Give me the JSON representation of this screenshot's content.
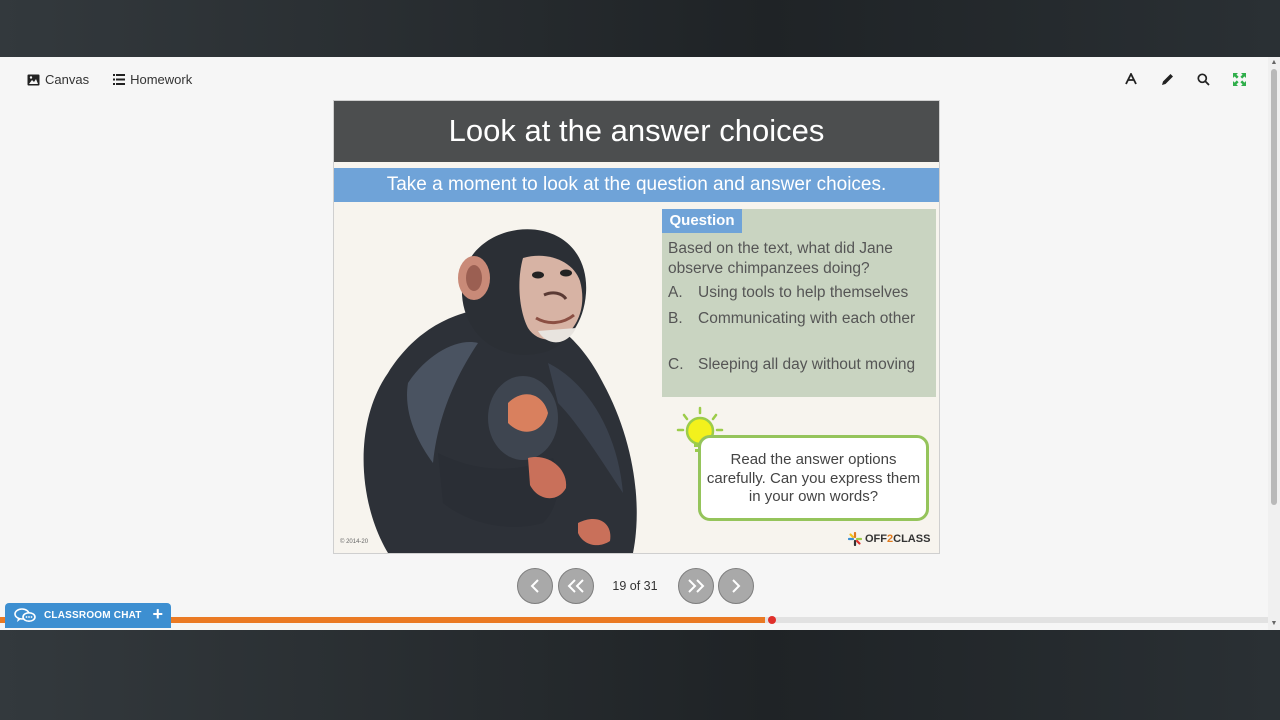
{
  "toolbar": {
    "canvas_label": "Canvas",
    "homework_label": "Homework",
    "icons": [
      "font-icon",
      "pencil-icon",
      "search-icon",
      "fullscreen-icon"
    ]
  },
  "slide": {
    "title": "Look at the answer choices",
    "subtitle": "Take a moment to look at the question and answer choices.",
    "question_badge": "Question",
    "question_text": "Based on the text, what did Jane observe chimpanzees doing?",
    "options": [
      {
        "letter": "A.",
        "text": "Using tools to help themselves"
      },
      {
        "letter": "B.",
        "text": "Communicating with each other"
      },
      {
        "letter": "C.",
        "text": "Sleeping all day without moving"
      }
    ],
    "tip": "Read the answer options carefully. Can you express them in your own words?",
    "copyright": "© 2014-20",
    "logo_prefix": "OFF",
    "logo_two": "2",
    "logo_suffix": "CLASS"
  },
  "navigation": {
    "page_indicator": "19 of 31",
    "current_page": 19,
    "total_pages": 31
  },
  "chat": {
    "label": "CLASSROOM CHAT",
    "plus": "+"
  },
  "progress": {
    "fraction": 0.603
  },
  "colors": {
    "accent_blue": "#6fa3d8",
    "progress_orange": "#ea7a24",
    "tip_green": "#95c45b",
    "title_bar": "#4c4e4f",
    "fullscreen_icon": "#2fae4a"
  }
}
